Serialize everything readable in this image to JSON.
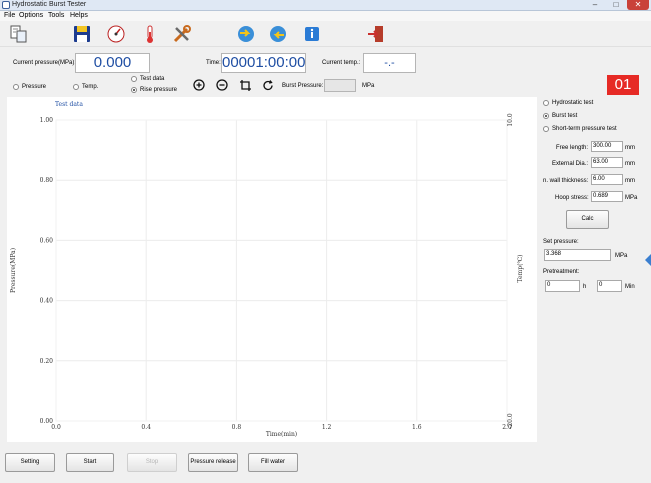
{
  "window": {
    "title": "Hydrostatic Burst Tester",
    "minimize": "–",
    "maximize": "□",
    "close": "✕"
  },
  "menu": [
    "File",
    "Options",
    "Tools",
    "Helps"
  ],
  "toolbar_icons": [
    "report-icon",
    "save-icon",
    "gauge-icon",
    "thermometer-icon",
    "tools-icon",
    "globe-left-icon",
    "globe-right-icon",
    "info-icon",
    "exit-icon"
  ],
  "readouts": {
    "pressure_label": "Current pressure(MPa):",
    "pressure_value": "0.000",
    "time_label": "Time:",
    "time_value": "00001:00:00",
    "temp_label": "Current temp.:",
    "temp_value": "-.-"
  },
  "plot_options": {
    "pressure": "Pressure",
    "temp": "Temp.",
    "test_data": "Test data",
    "rise_pressure": "Rise pressure",
    "burst_pressure_label": "Burst Pressure:",
    "burst_pressure_value": "",
    "burst_unit": "MPa"
  },
  "station_badge": "01",
  "test_modes": {
    "hydrostatic": "Hydrostatic test",
    "burst": "Burst test",
    "short_term": "Short-term pressure test"
  },
  "params": {
    "free_length_label": "Free length:",
    "free_length": "300.00",
    "free_length_unit": "mm",
    "ext_dia_label": "External Dia.:",
    "ext_dia": "63.00",
    "ext_dia_unit": "mm",
    "wall_label": "n. wall thickness:",
    "wall": "6.00",
    "wall_unit": "mm",
    "hoop_label": "Hoop stress:",
    "hoop": "0.689",
    "hoop_unit": "MPa"
  },
  "calc_label": "Calc",
  "set_pressure": {
    "label": "Set pressure:",
    "value": "3.368",
    "unit": "MPa"
  },
  "pretreatment": {
    "label": "Pretreatment:",
    "hours": "0",
    "h_unit": "h",
    "minutes": "0",
    "min_unit": "Min"
  },
  "buttons": {
    "setting": "Setting",
    "start": "Start",
    "stop": "Stop",
    "release": "Pressure release",
    "fill": "Fill water"
  },
  "chart_data": {
    "type": "line",
    "title": "Test data",
    "xlabel": "Time(min)",
    "ylabel": "Pressure(MPa)",
    "y2label": "Temp(℃)",
    "xlim": [
      0.0,
      2.0
    ],
    "ylim": [
      0.0,
      1.0
    ],
    "y2lim": [
      -20.0,
      10.0
    ],
    "x_ticks": [
      "0.0",
      "0.4",
      "0.8",
      "1.2",
      "1.6",
      "2.0"
    ],
    "y_ticks": [
      "1.00",
      "0.80",
      "0.60",
      "0.40",
      "0.20",
      "0.00"
    ],
    "y2_ticks": [
      "10.0",
      "-20.0"
    ],
    "grid": true,
    "series": []
  }
}
